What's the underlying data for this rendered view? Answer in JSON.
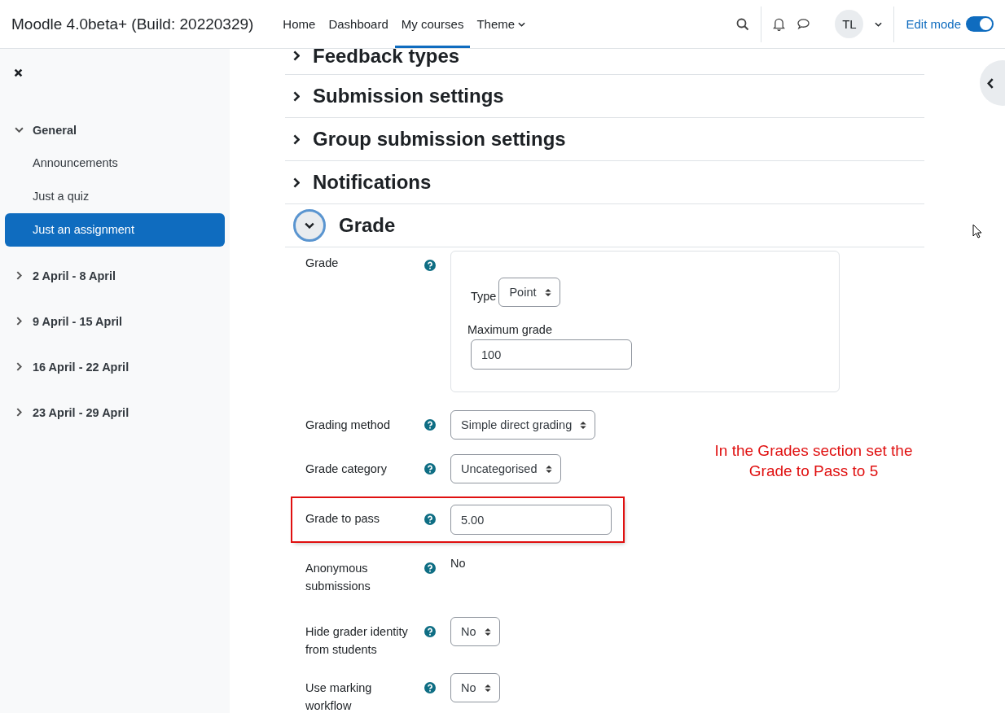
{
  "site_name": "Moodle 4.0beta+ (Build: 20220329)",
  "nav": [
    {
      "label": "Home",
      "selected": false,
      "has_menu": false
    },
    {
      "label": "Dashboard",
      "selected": false,
      "has_menu": false
    },
    {
      "label": "My courses",
      "selected": true,
      "has_menu": false
    },
    {
      "label": "Theme",
      "selected": false,
      "has_menu": true
    }
  ],
  "user": {
    "initials": "TL"
  },
  "edit_mode": {
    "label": "Edit mode",
    "on": true
  },
  "sidebar": {
    "sections": [
      {
        "title": "General",
        "expanded": true,
        "children": [
          {
            "label": "Announcements",
            "selected": false
          },
          {
            "label": "Just a quiz",
            "selected": false
          },
          {
            "label": "Just an assignment",
            "selected": true
          }
        ]
      },
      {
        "title": "2 April - 8 April",
        "expanded": false
      },
      {
        "title": "9 April - 15 April",
        "expanded": false
      },
      {
        "title": "16 April - 22 April",
        "expanded": false
      },
      {
        "title": "23 April - 29 April",
        "expanded": false
      }
    ]
  },
  "sections": [
    {
      "title": "Feedback types",
      "expanded": false
    },
    {
      "title": "Submission settings",
      "expanded": false
    },
    {
      "title": "Group submission settings",
      "expanded": false
    },
    {
      "title": "Notifications",
      "expanded": false
    },
    {
      "title": "Grade",
      "expanded": true
    }
  ],
  "grade_fields": [
    {
      "kind": "group",
      "label": "Grade",
      "highlighted": false,
      "type_label": "Type",
      "type_value": "Point",
      "max_label": "Maximum grade",
      "max_value": "100"
    },
    {
      "kind": "select",
      "label": "Grading method",
      "highlighted": false,
      "value": "Simple direct grading"
    },
    {
      "kind": "select",
      "label": "Grade category",
      "highlighted": false,
      "value": "Uncategorised"
    },
    {
      "kind": "text",
      "label": "Grade to pass",
      "highlighted": true,
      "value": "5.00"
    },
    {
      "kind": "static",
      "label": "Anonymous submissions",
      "highlighted": false,
      "value": "No"
    },
    {
      "kind": "select",
      "label": "Hide grader identity from students",
      "highlighted": false,
      "value": "No"
    },
    {
      "kind": "select",
      "label": "Use marking workflow",
      "highlighted": false,
      "value": "No"
    }
  ],
  "annotation": "In the Grades section set the Grade to Pass to 5"
}
